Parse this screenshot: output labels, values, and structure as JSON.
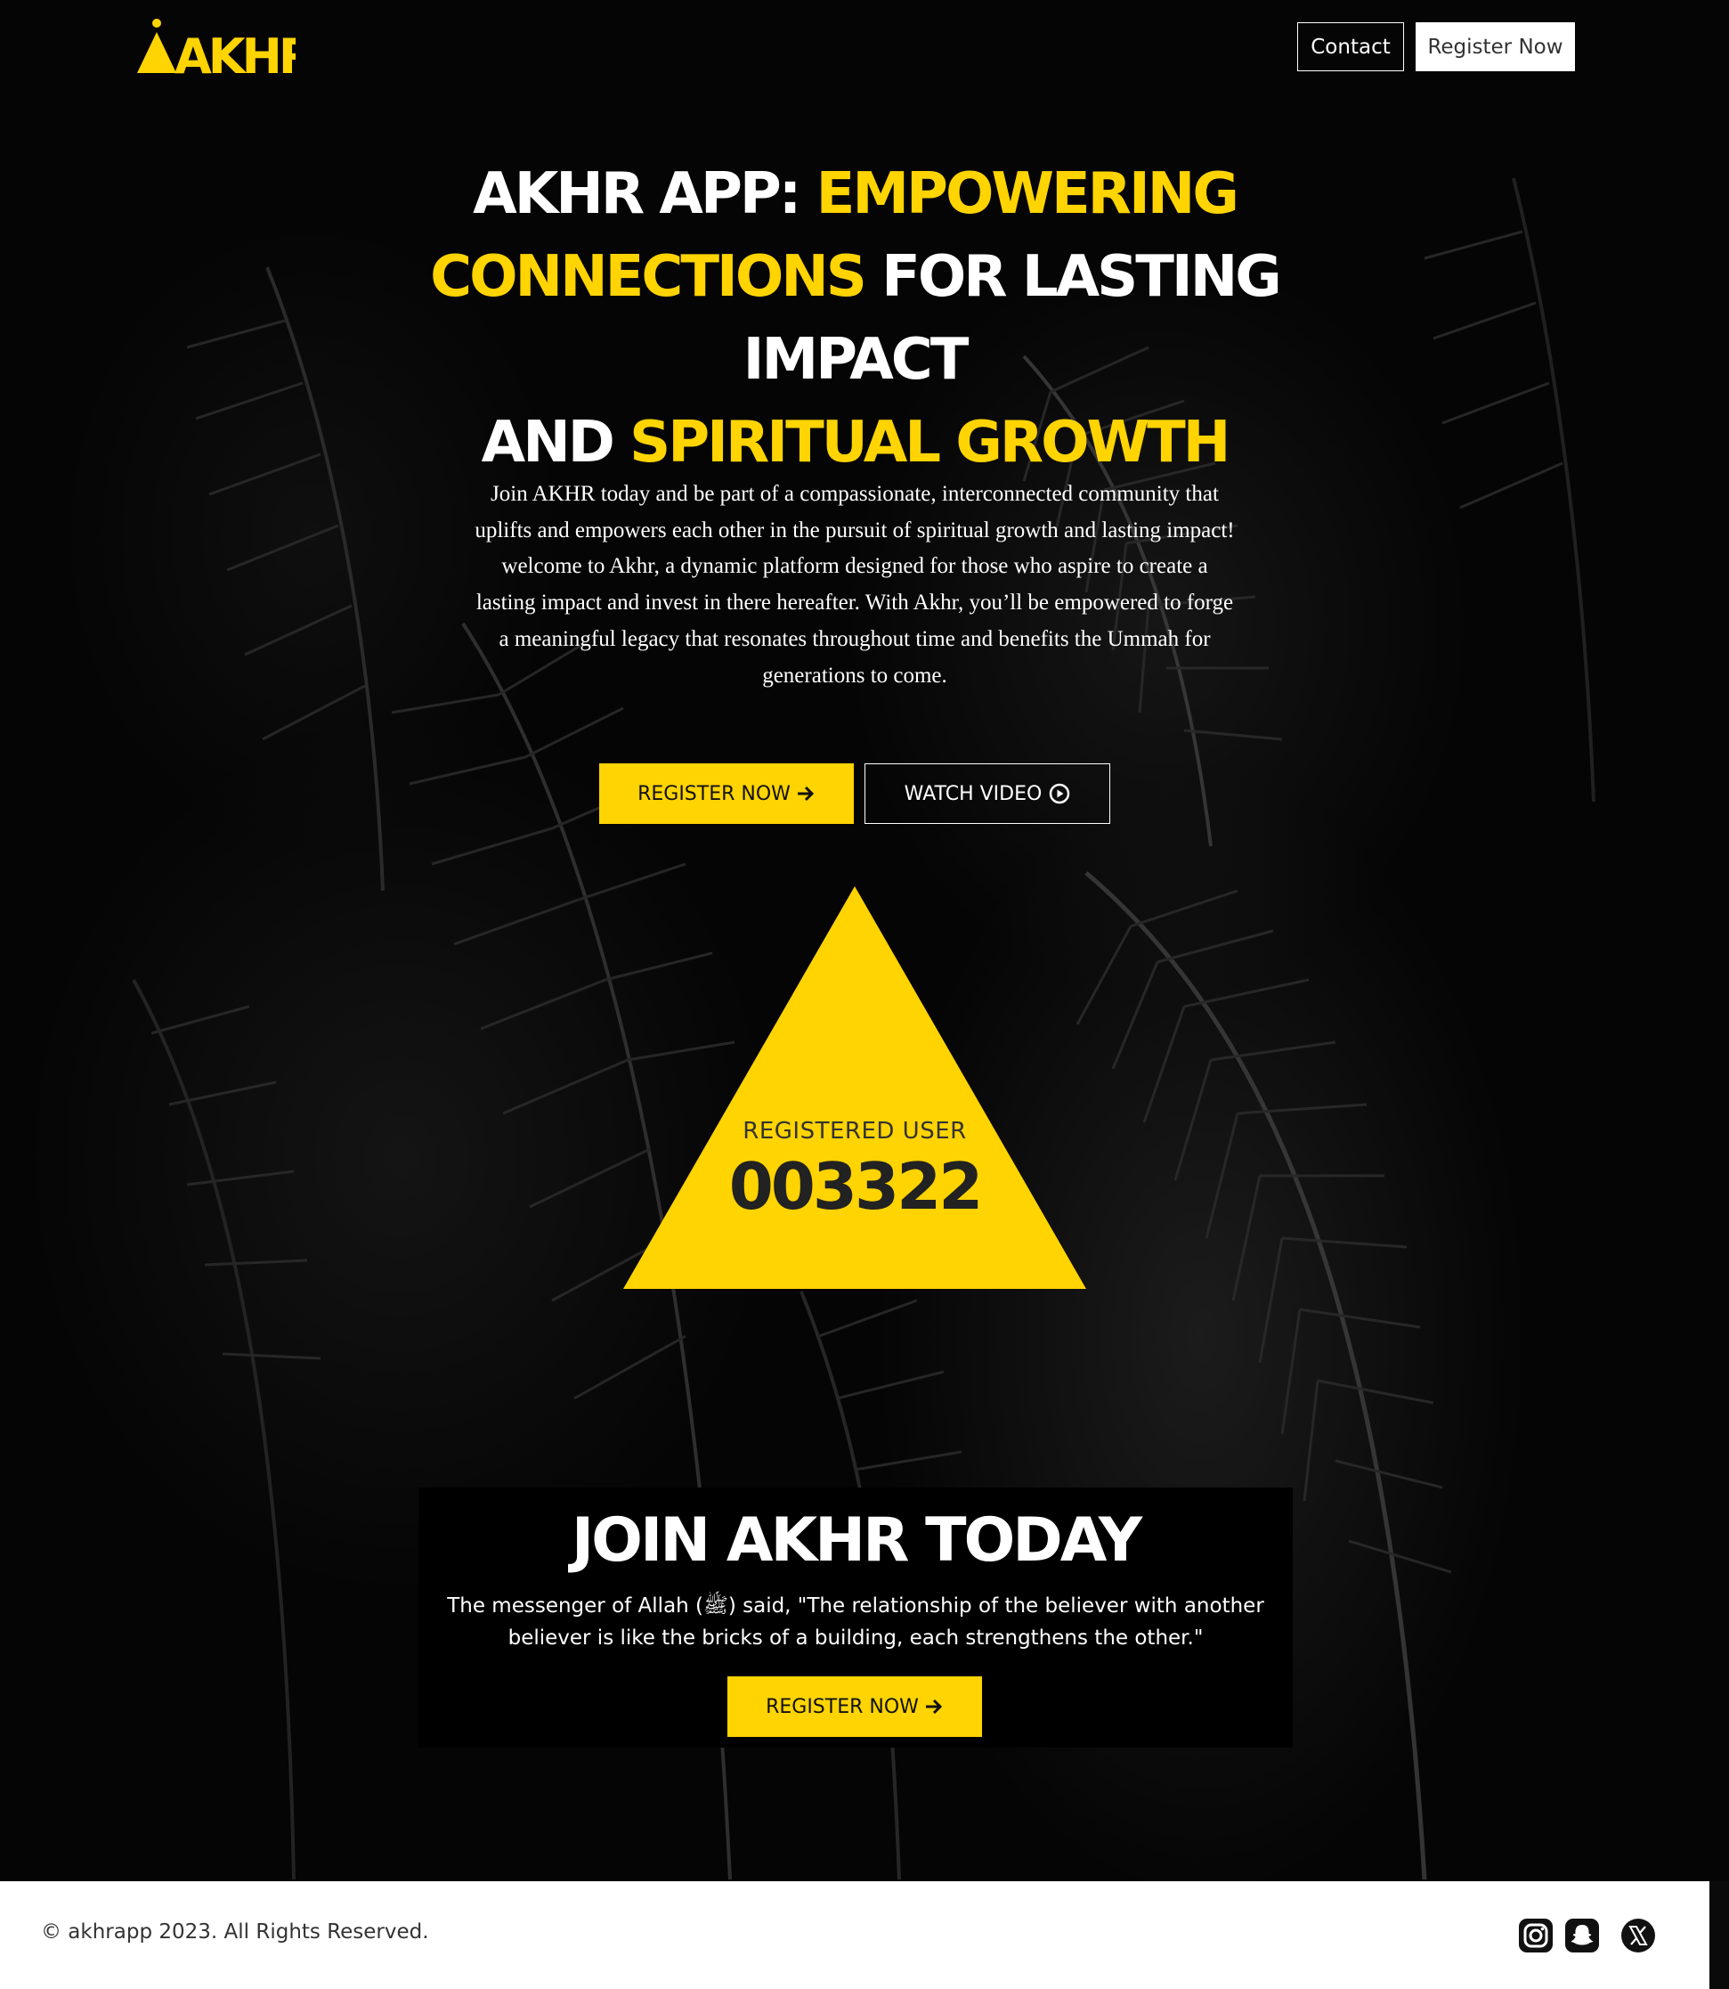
{
  "header": {
    "logo_text": "AKHR",
    "contact_label": "Contact",
    "register_label": "Register Now"
  },
  "hero": {
    "title_parts": [
      "AKHR APP: ",
      "EMPOWERING",
      "CONNECTIONS",
      " FOR LASTING IMPACT",
      "AND ",
      "SPIRITUAL GROWTH"
    ],
    "description": "Join AKHR today and be part of a compassionate, interconnected community that uplifts and empowers each other in the pursuit of spiritual growth and lasting impact! welcome to Akhr, a dynamic platform designed for those who aspire to create a lasting impact and invest in there hereafter. With Akhr, you’ll be empowered to forge a meaningful legacy that resonates throughout time and benefits the Ummah for generations to come.",
    "register_label": "REGISTER NOW",
    "watch_label": "WATCH VIDEO"
  },
  "stats": {
    "label": "REGISTERED USER",
    "count": "003322"
  },
  "join": {
    "title": "JOIN AKHR TODAY",
    "quote": "The messenger of Allah (ﷺ) said, \"The relationship of the believer with another believer is like the bricks of a building, each strengthens the other.\"",
    "register_label": "REGISTER NOW"
  },
  "footer": {
    "copyright": "© akhrapp 2023. All Rights Reserved.",
    "social_icons": [
      "instagram-icon",
      "snapchat-icon",
      "x-twitter-icon"
    ]
  },
  "colors": {
    "accent": "#ffd400",
    "background": "#050505",
    "footer_bg": "#ffffff"
  }
}
